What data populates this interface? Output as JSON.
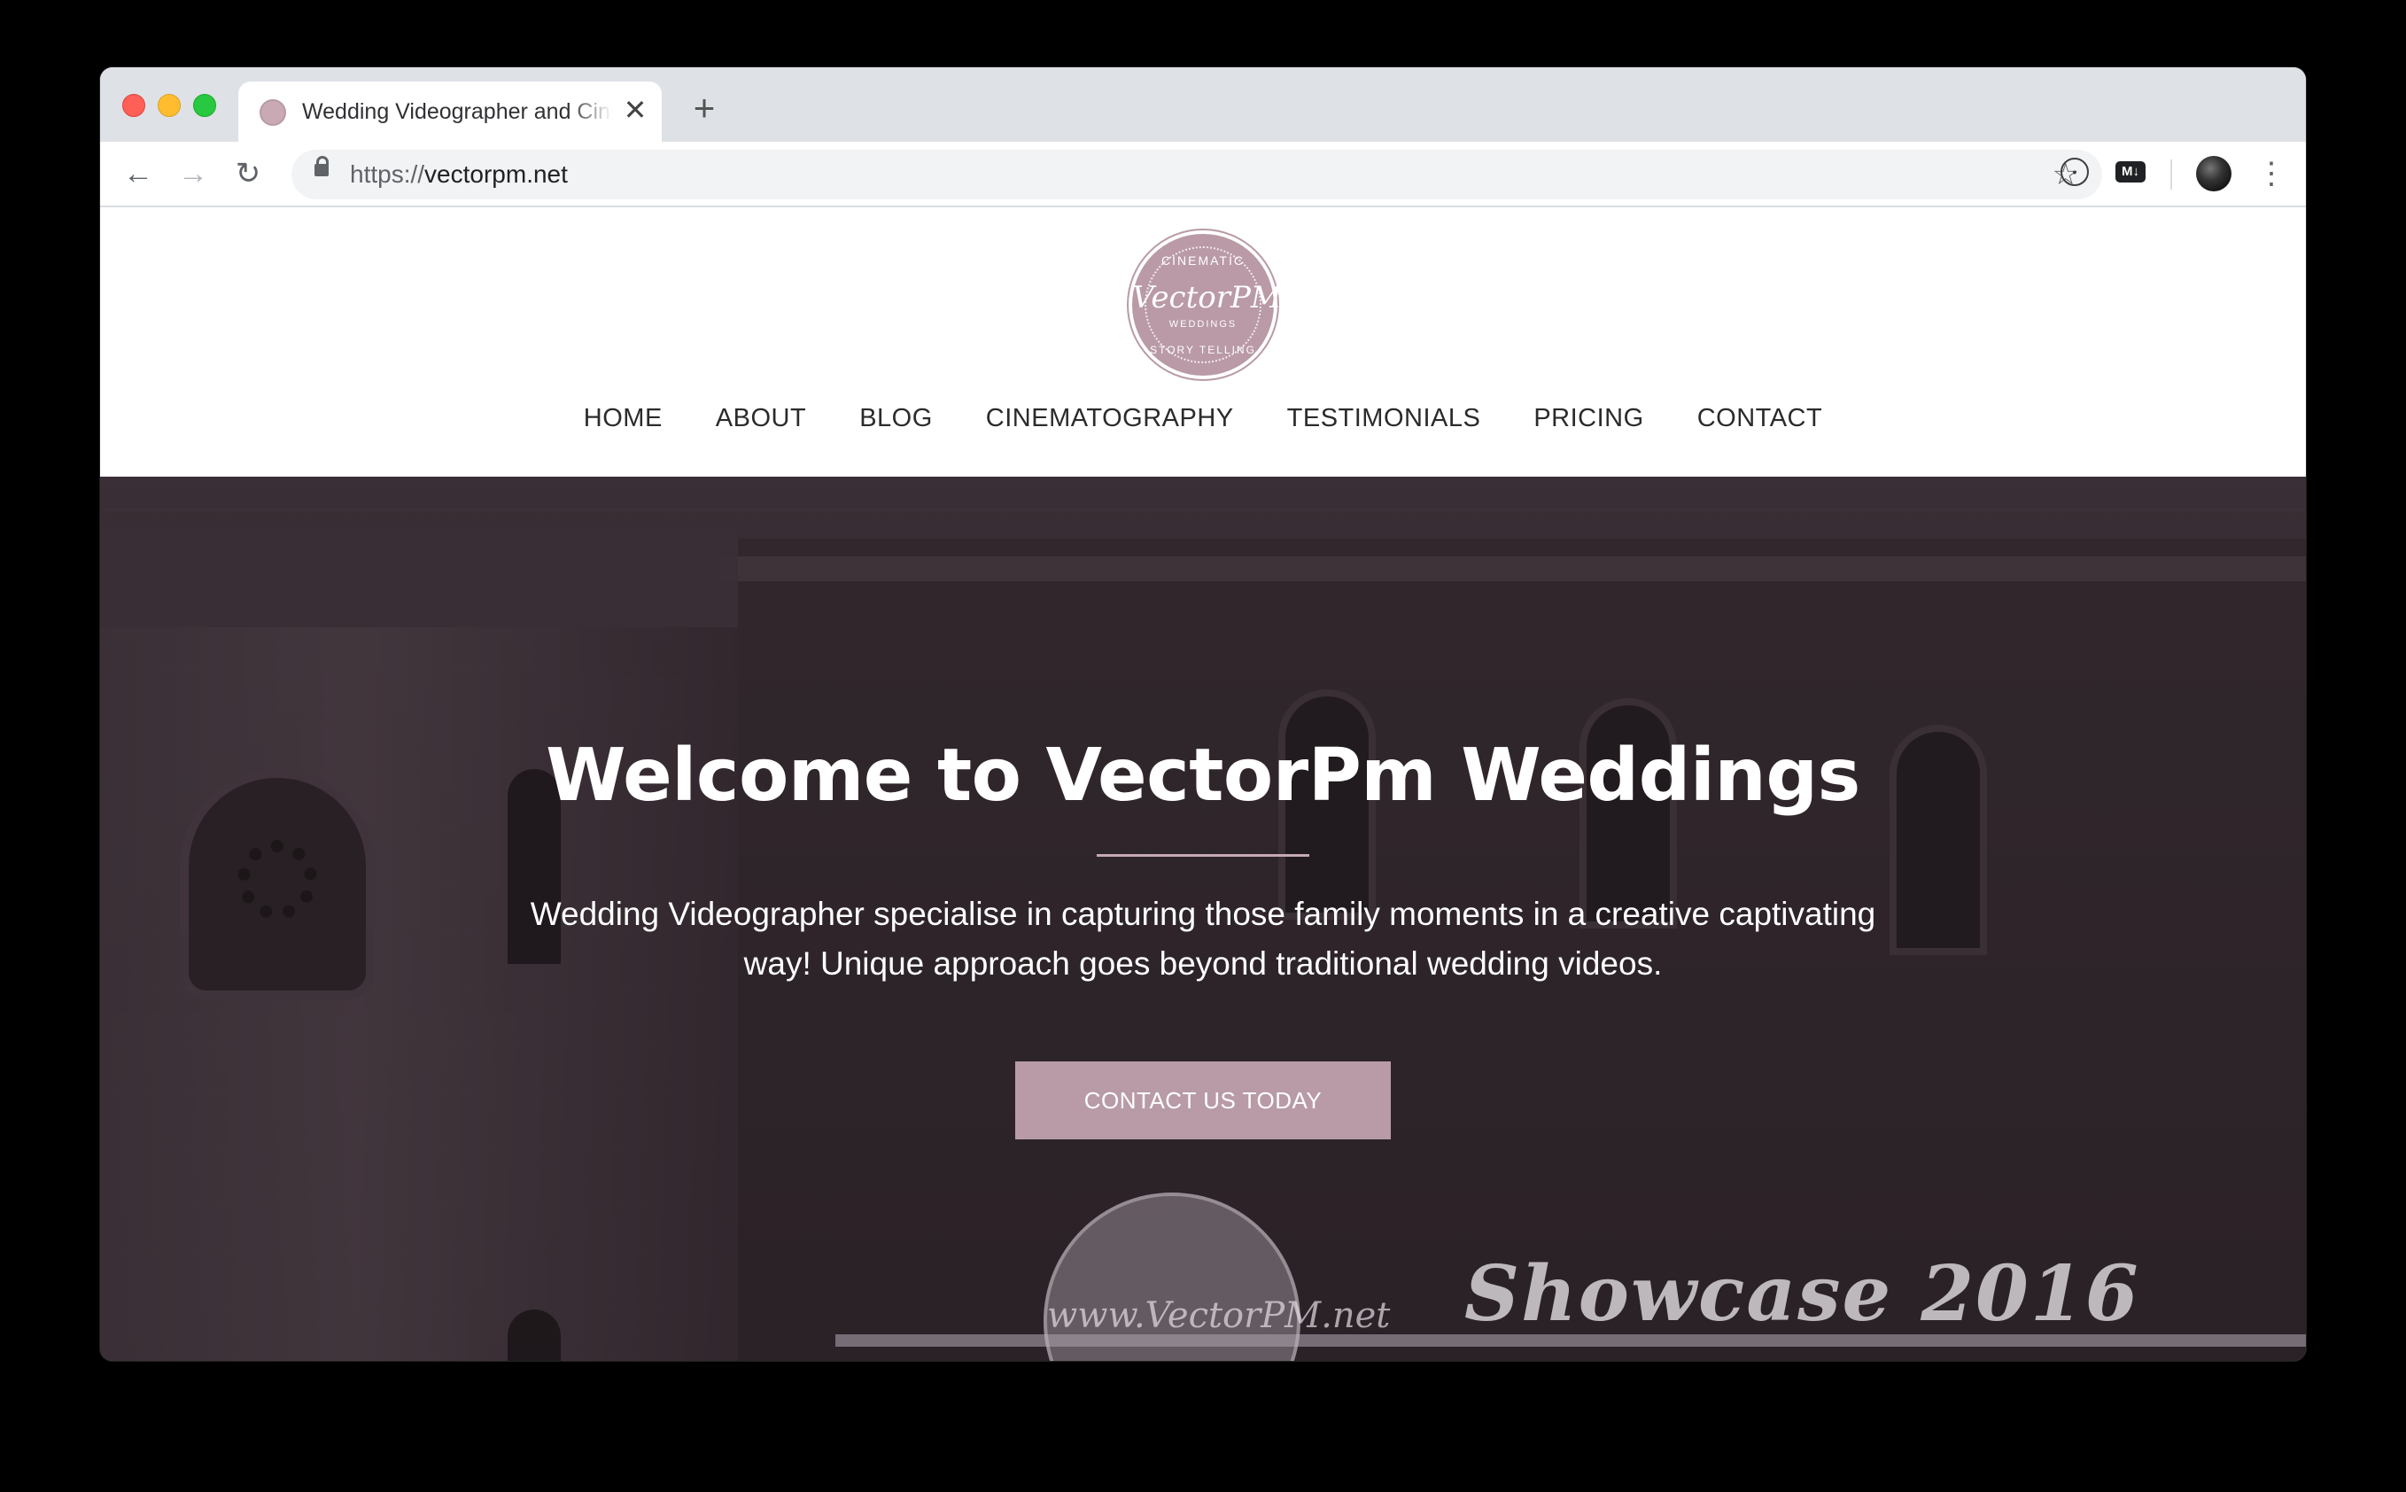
{
  "browser": {
    "tab_title": "Wedding Videographer and Cinematography",
    "tab_close": "✕",
    "new_tab": "+",
    "url_scheme": "https://",
    "url_host": "vectorpm.net",
    "back": "←",
    "forward": "→",
    "reload": "↻",
    "bookmark_star": "☆",
    "menu": "⋮",
    "ext_md_label": "M↓"
  },
  "site": {
    "logo": {
      "top": "CINEMATIC",
      "main": "VectorPM",
      "sub": "WEDDINGS",
      "bottom": "STORY TELLING"
    },
    "nav": [
      {
        "label": "HOME"
      },
      {
        "label": "ABOUT"
      },
      {
        "label": "BLOG"
      },
      {
        "label": "CINEMATOGRAPHY"
      },
      {
        "label": "TESTIMONIALS"
      },
      {
        "label": "PRICING"
      },
      {
        "label": "CONTACT"
      }
    ]
  },
  "hero": {
    "title": "Welcome to VectorPm Weddings",
    "text": "Wedding Videographer specialise in capturing those family moments in a creative captivating way! Unique approach goes beyond traditional wedding videos.",
    "cta": "CONTACT US TODAY",
    "video_logo_text": "www.VectorPM.net",
    "video_caption": "Showcase 2016"
  },
  "colors": {
    "brand_mauve": "#b89ba6",
    "nav_text": "#2b2b2b",
    "chrome_tabbar": "#dee1e6"
  }
}
